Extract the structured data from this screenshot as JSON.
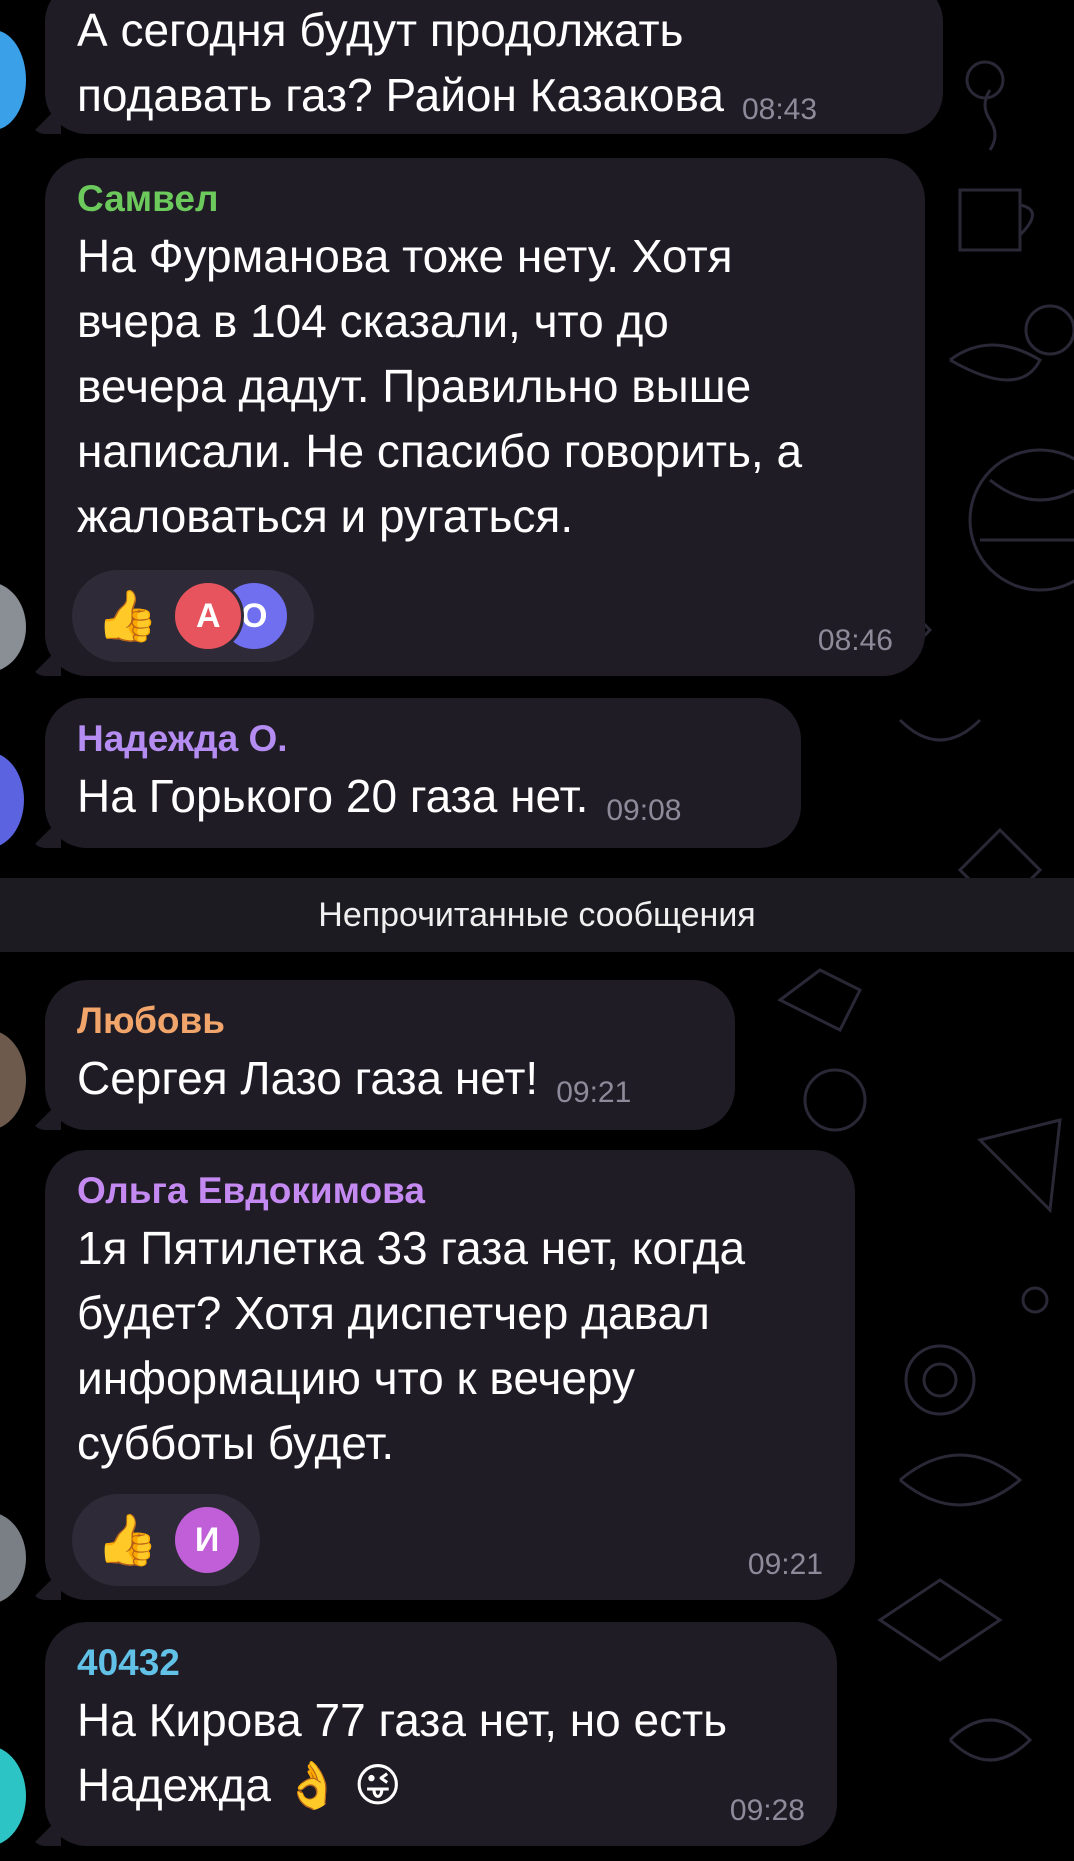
{
  "unread_divider": "Непрочитанные сообщения",
  "messages": [
    {
      "sender": "",
      "text": "А сегодня будут продолжать\nподавать газ? Район Казакова",
      "time": "08:43"
    },
    {
      "sender": "Самвел",
      "sender_color": "#6cc95c",
      "text": "На Фурманова тоже нету. Хотя\nвчера в 104 сказали, что до\nвечера дадут. Правильно выше\nнаписали. Не спасибо говорить, а\nжаловаться и ругаться.",
      "time": "08:46",
      "reaction_icon": "👍",
      "reaction_avatars": [
        {
          "letter": "А",
          "color": "#e8545e"
        },
        {
          "letter": "О",
          "color": "#6f6ff0"
        }
      ]
    },
    {
      "sender": "Надежда О.",
      "sender_color": "#b58cf2",
      "text": "На Горького 20 газа нет.",
      "time": "09:08"
    },
    {
      "sender": "Любовь",
      "sender_color": "#f2a56a",
      "text": "Сергея Лазо газа нет!",
      "time": "09:21"
    },
    {
      "sender": "Ольга Евдокимова",
      "sender_color": "#c58af2",
      "text": "1я Пятилетка 33 газа нет, когда\nбудет? Хотя диспетчер давал\nинформацию что к вечеру\nсубботы будет.",
      "time": "09:21",
      "reaction_icon": "👍",
      "reaction_avatars": [
        {
          "letter": "И",
          "color": "#c05fd8"
        }
      ]
    },
    {
      "sender": "40432",
      "sender_color": "#62c1e6",
      "text": "На Кирова 77 газа нет, но есть\nНадежда 👌 😜",
      "time": "09:28"
    }
  ]
}
